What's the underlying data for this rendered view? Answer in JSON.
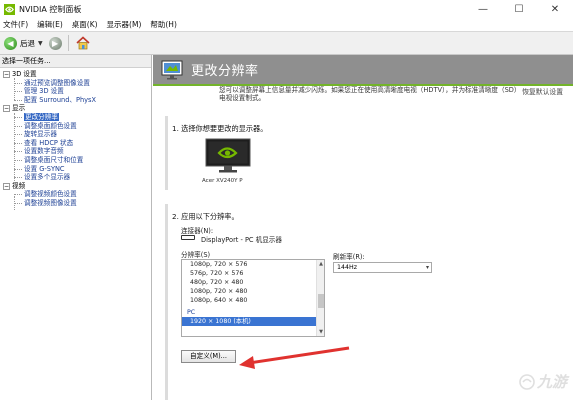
{
  "window": {
    "title": "NVIDIA 控制面板",
    "icon": "nvidia-logo-icon"
  },
  "menubar": {
    "items": [
      "文件(F)",
      "编辑(E)",
      "桌面(K)",
      "显示器(M)",
      "帮助(H)"
    ]
  },
  "toolbar": {
    "back_label": "后退"
  },
  "left_panel": {
    "header": "选择一项任务...",
    "tree": [
      {
        "type": "cat",
        "label": "3D 设置",
        "toggle": "−"
      },
      {
        "type": "item",
        "label": "通过预览调整图像设置"
      },
      {
        "type": "item",
        "label": "管理 3D 设置"
      },
      {
        "type": "item",
        "label": "配置 Surround、PhysX"
      },
      {
        "type": "cat",
        "label": "显示",
        "toggle": "−"
      },
      {
        "type": "item",
        "label": "更改分辨率",
        "selected": true
      },
      {
        "type": "item",
        "label": "调整桌面颜色设置"
      },
      {
        "type": "item",
        "label": "旋转显示器"
      },
      {
        "type": "item",
        "label": "查看 HDCP 状态"
      },
      {
        "type": "item",
        "label": "设置数字音频"
      },
      {
        "type": "item",
        "label": "调整桌面尺寸和位置"
      },
      {
        "type": "item",
        "label": "设置 G-SYNC"
      },
      {
        "type": "item",
        "label": "设置多个显示器"
      },
      {
        "type": "cat",
        "label": "视频",
        "toggle": "−"
      },
      {
        "type": "item",
        "label": "调整视频颜色设置"
      },
      {
        "type": "item",
        "label": "调整视频图像设置"
      }
    ]
  },
  "right_panel": {
    "title": "更改分辨率",
    "restore_link": "恢复默认设置",
    "description": "您可以调整屏幕上信息量并减少闪烁。如果您正在使用高清晰度电视（HDTV），并为标准清晰度（SD）电视设置制式。",
    "section1": {
      "title": "1. 选择你想要更改的显示器。",
      "monitor_label": "Acer XV240Y P"
    },
    "section2": {
      "title": "2. 应用以下分辨率。",
      "connector_label": "连接器(N):",
      "connector_value": "DisplayPort - PC 机显示器",
      "resolution_label": "分辨率(S)",
      "resolutions": [
        {
          "label": "1080p, 720 × 576",
          "kind": "row"
        },
        {
          "label": "576p, 720 × 576",
          "kind": "row"
        },
        {
          "label": "480p, 720 × 480",
          "kind": "row"
        },
        {
          "label": "1080p, 720 × 480",
          "kind": "row"
        },
        {
          "label": "1080p, 640 × 480",
          "kind": "row"
        },
        {
          "label": "PC",
          "kind": "group"
        },
        {
          "label": "1920 × 1080 (本机)",
          "kind": "selected"
        }
      ],
      "refresh_label": "刷新率(R):",
      "refresh_value": "144Hz",
      "custom_button": "自定义(M)..."
    }
  },
  "watermark": {
    "text": "九游",
    "icon": "jiuyou-logo-icon"
  },
  "colors": {
    "header_band": "#8f8f8f",
    "nvidia_green": "#76b900",
    "selection_blue": "#3a74d2",
    "arrow_red": "#e0322f"
  }
}
